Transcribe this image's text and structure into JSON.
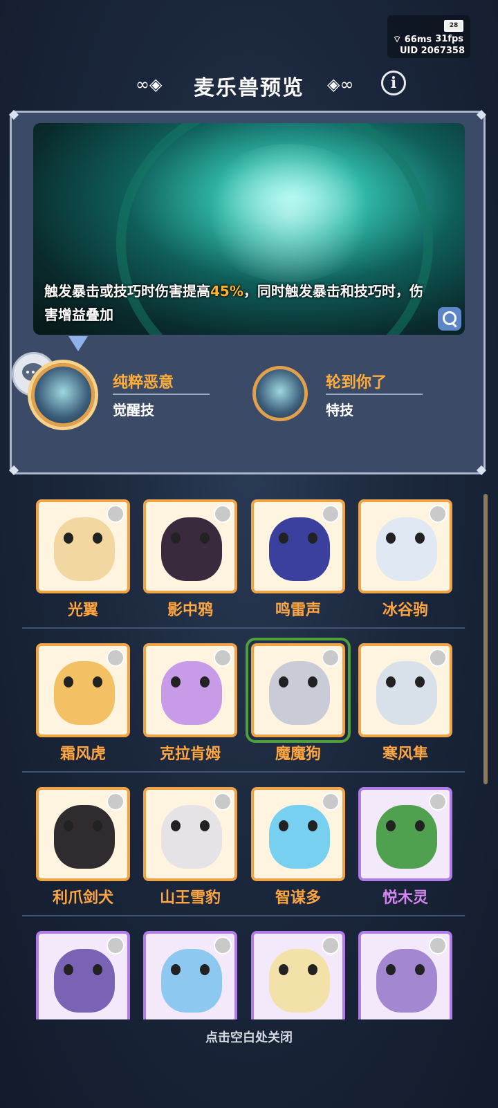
{
  "status": {
    "battery": "28",
    "ping": "66ms",
    "fps": "31fps",
    "uid": "UID 2067358"
  },
  "header": {
    "title": "麦乐兽预览",
    "info_icon": "info-icon"
  },
  "preview": {
    "description_pre": "触发暴击或技巧时伤害提高",
    "description_value": "45%",
    "description_post": "，同时触发暴击和技巧时，伤害增益叠加",
    "zoom_icon": "zoom-in-icon"
  },
  "skills": [
    {
      "name": "纯粹恶意",
      "type": "觉醒技"
    },
    {
      "name": "轮到你了",
      "type": "特技"
    }
  ],
  "pets": [
    {
      "name": "光翼",
      "rarity": "gold",
      "color": "#f3d7a0"
    },
    {
      "name": "影中鸦",
      "rarity": "gold",
      "color": "#3a2a3e"
    },
    {
      "name": "鸣雷声",
      "rarity": "gold",
      "color": "#3b3f9e"
    },
    {
      "name": "冰谷驹",
      "rarity": "gold",
      "color": "#dfe8f3"
    },
    {
      "name": "霜风虎",
      "rarity": "gold",
      "color": "#f3c063"
    },
    {
      "name": "克拉肯姆",
      "rarity": "gold",
      "color": "#c79be8"
    },
    {
      "name": "魔魔狗",
      "rarity": "gold",
      "color": "#c9ccd6",
      "selected": true
    },
    {
      "name": "寒风隼",
      "rarity": "gold",
      "color": "#d8e0ea"
    },
    {
      "name": "利爪剑犬",
      "rarity": "gold",
      "color": "#2f2b2e"
    },
    {
      "name": "山王雪豹",
      "rarity": "gold",
      "color": "#e6e3e6"
    },
    {
      "name": "智谋多",
      "rarity": "gold",
      "color": "#78d0f0"
    },
    {
      "name": "悦木灵",
      "rarity": "purple",
      "color": "#4fa14f"
    },
    {
      "name": "",
      "rarity": "purple",
      "color": "#7a63b4"
    },
    {
      "name": "",
      "rarity": "purple",
      "color": "#8cc8ef"
    },
    {
      "name": "",
      "rarity": "purple",
      "color": "#f2e1a8"
    },
    {
      "name": "",
      "rarity": "purple",
      "color": "#a387d0"
    }
  ],
  "footer": {
    "close_hint": "点击空白处关闭"
  }
}
